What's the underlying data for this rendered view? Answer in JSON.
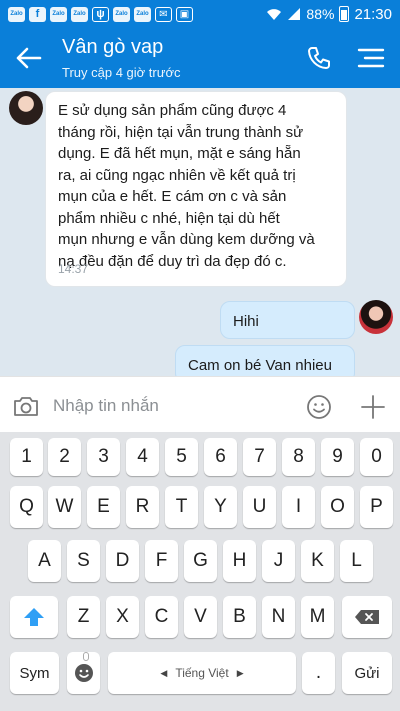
{
  "status_bar": {
    "notification_icons": [
      "Zalo",
      "f",
      "Zalo",
      "Zalo",
      "ψ",
      "Zalo",
      "Zalo",
      "✉",
      "▣"
    ],
    "battery": "88%",
    "time": "21:30"
  },
  "header": {
    "title": "Vân gò vap",
    "subtitle": "Truy cập 4 giờ trước"
  },
  "messages": [
    {
      "direction": "incoming",
      "lines": [
        "E sử dụng sản phẩm cũng được 4",
        "tháng rồi, hiện tại vẫn trung thành sử",
        "dụng. E đã hết mụn, mặt e sáng hẵn",
        "ra, ai cũng ngạc nhiên về kết quả trị",
        "mụn của e hết. E cám ơn c và sản",
        "phẩm nhiều c nhé, hiện tại dù hết",
        "mụn nhưng e vẫn dùng kem dưỡng và",
        "nạ đều đặn để duy trì da đẹp đó c."
      ],
      "time": "14:37"
    },
    {
      "direction": "outgoing",
      "text": "Hihi"
    },
    {
      "direction": "outgoing",
      "text": "Cam on bé Van nhieu"
    }
  ],
  "composer": {
    "placeholder": "Nhập tin nhắn"
  },
  "keyboard": {
    "row1": [
      "1",
      "2",
      "3",
      "4",
      "5",
      "6",
      "7",
      "8",
      "9",
      "0"
    ],
    "row2": [
      "Q",
      "W",
      "E",
      "R",
      "T",
      "Y",
      "U",
      "I",
      "O",
      "P"
    ],
    "row3": [
      "A",
      "S",
      "D",
      "F",
      "G",
      "H",
      "J",
      "K",
      "L"
    ],
    "row4": [
      "Z",
      "X",
      "C",
      "V",
      "B",
      "N",
      "M"
    ],
    "sym_label": "Sym",
    "space_label": "Tiếng Việt",
    "period_label": ".",
    "send_label": "Gửi"
  },
  "colors": {
    "header_blue": "#0a7fd9",
    "incoming_bubble": "#ffffff",
    "outgoing_bubble": "#d5ecfd",
    "chat_background": "#dde7ef",
    "shift_key_accent": "#2f9ff5"
  },
  "icons": {
    "back": "back-arrow-icon",
    "call": "phone-icon",
    "menu": "menu-icon",
    "camera": "camera-icon",
    "emoji": "emoji-icon",
    "plus": "plus-icon",
    "shift": "shift-icon",
    "backspace": "backspace-icon"
  }
}
